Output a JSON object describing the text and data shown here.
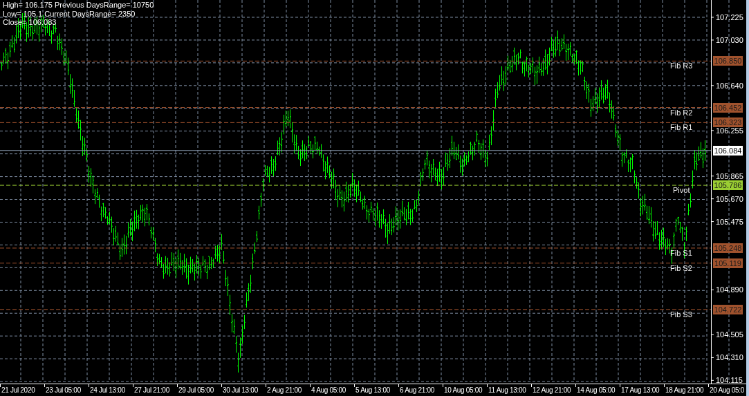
{
  "info": [
    "High= 106.175 Previous DaysRange= 10750",
    "Low= 105.1 Current DaysRange= 2350",
    "Close= 106.083"
  ],
  "levels": [
    {
      "label": "Fib R3",
      "price": "106.850",
      "color": "#a0522d"
    },
    {
      "label": "Fib R2",
      "price": "106.452",
      "color": "#a0522d"
    },
    {
      "label": "Fib R1",
      "price": "106.323",
      "color": "#a0522d"
    },
    {
      "label": "Pivot",
      "price": "105.786",
      "color": "#9acd32"
    },
    {
      "label": "Fib S1",
      "price": "105.248",
      "color": "#a0522d"
    },
    {
      "label": "Fib S2",
      "price": "105.119",
      "color": "#a0522d"
    },
    {
      "label": "Fib S3",
      "price": "104.722",
      "color": "#a0522d"
    }
  ],
  "current_price": "106.084",
  "y_axis": [
    "107.225",
    "107.030",
    "106.640",
    "106.255",
    "105.865",
    "105.670",
    "105.475",
    "104.890",
    "104.505",
    "104.310",
    "104.115"
  ],
  "x_axis": [
    "21 Jul 2020",
    "23 Jul 05:00",
    "24 Jul 13:00",
    "27 Jul 21:00",
    "29 Jul 05:00",
    "30 Jul 13:00",
    "2 Aug 21:00",
    "4 Aug 05:00",
    "5 Aug 13:00",
    "6 Aug 21:00",
    "10 Aug 05:00",
    "11 Aug 13:00",
    "12 Aug 21:00",
    "14 Aug 05:00",
    "17 Aug 13:00",
    "18 Aug 21:00",
    "20 Aug 05:0"
  ]
}
